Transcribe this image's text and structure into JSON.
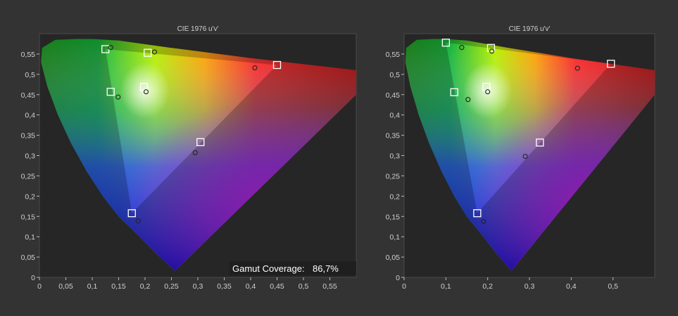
{
  "chart_data": [
    {
      "type": "scatter",
      "title": "CIE 1976 u'v'",
      "xlim": [
        0,
        0.6
      ],
      "ylim": [
        0,
        0.6
      ],
      "x_ticks": [
        "0",
        "0,05",
        "0,1",
        "0,15",
        "0,2",
        "0,25",
        "0,3",
        "0,35",
        "0,4",
        "0,45",
        "0,5",
        "0,55"
      ],
      "y_ticks": [
        "0",
        "0,05",
        "0,1",
        "0,15",
        "0,2",
        "0,25",
        "0,3",
        "0,35",
        "0,4",
        "0,45",
        "0,5",
        "0,55"
      ],
      "annotation": {
        "label": "Gamut Coverage:",
        "value": "86,7%"
      },
      "series": [
        {
          "marker": "square",
          "points": [
            [
              0.125,
              0.562
            ],
            [
              0.205,
              0.553
            ],
            [
              0.45,
              0.523
            ],
            [
              0.135,
              0.457
            ],
            [
              0.198,
              0.469
            ],
            [
              0.305,
              0.333
            ],
            [
              0.175,
              0.158
            ]
          ]
        },
        {
          "marker": "circle",
          "points": [
            [
              0.135,
              0.566
            ],
            [
              0.218,
              0.555
            ],
            [
              0.408,
              0.516
            ],
            [
              0.149,
              0.444
            ],
            [
              0.202,
              0.457
            ],
            [
              0.295,
              0.307
            ],
            [
              0.187,
              0.139
            ]
          ]
        }
      ]
    },
    {
      "type": "scatter",
      "title": "CIE 1976 u'v'",
      "xlim": [
        0,
        0.6
      ],
      "ylim": [
        0,
        0.6
      ],
      "x_ticks": [
        "0",
        "0,1",
        "0,2",
        "0,3",
        "0,4",
        "0,5"
      ],
      "y_ticks": [
        "0",
        "0,05",
        "0,1",
        "0,15",
        "0,2",
        "0,25",
        "0,3",
        "0,35",
        "0,4",
        "0,45",
        "0,5",
        "0,55"
      ],
      "series": [
        {
          "marker": "square",
          "points": [
            [
              0.1,
              0.578
            ],
            [
              0.208,
              0.565
            ],
            [
              0.495,
              0.526
            ],
            [
              0.12,
              0.456
            ],
            [
              0.197,
              0.469
            ],
            [
              0.325,
              0.332
            ],
            [
              0.175,
              0.158
            ]
          ]
        },
        {
          "marker": "circle",
          "points": [
            [
              0.138,
              0.566
            ],
            [
              0.21,
              0.557
            ],
            [
              0.415,
              0.515
            ],
            [
              0.153,
              0.438
            ],
            [
              0.2,
              0.457
            ],
            [
              0.29,
              0.298
            ],
            [
              0.19,
              0.138
            ]
          ]
        }
      ]
    }
  ]
}
